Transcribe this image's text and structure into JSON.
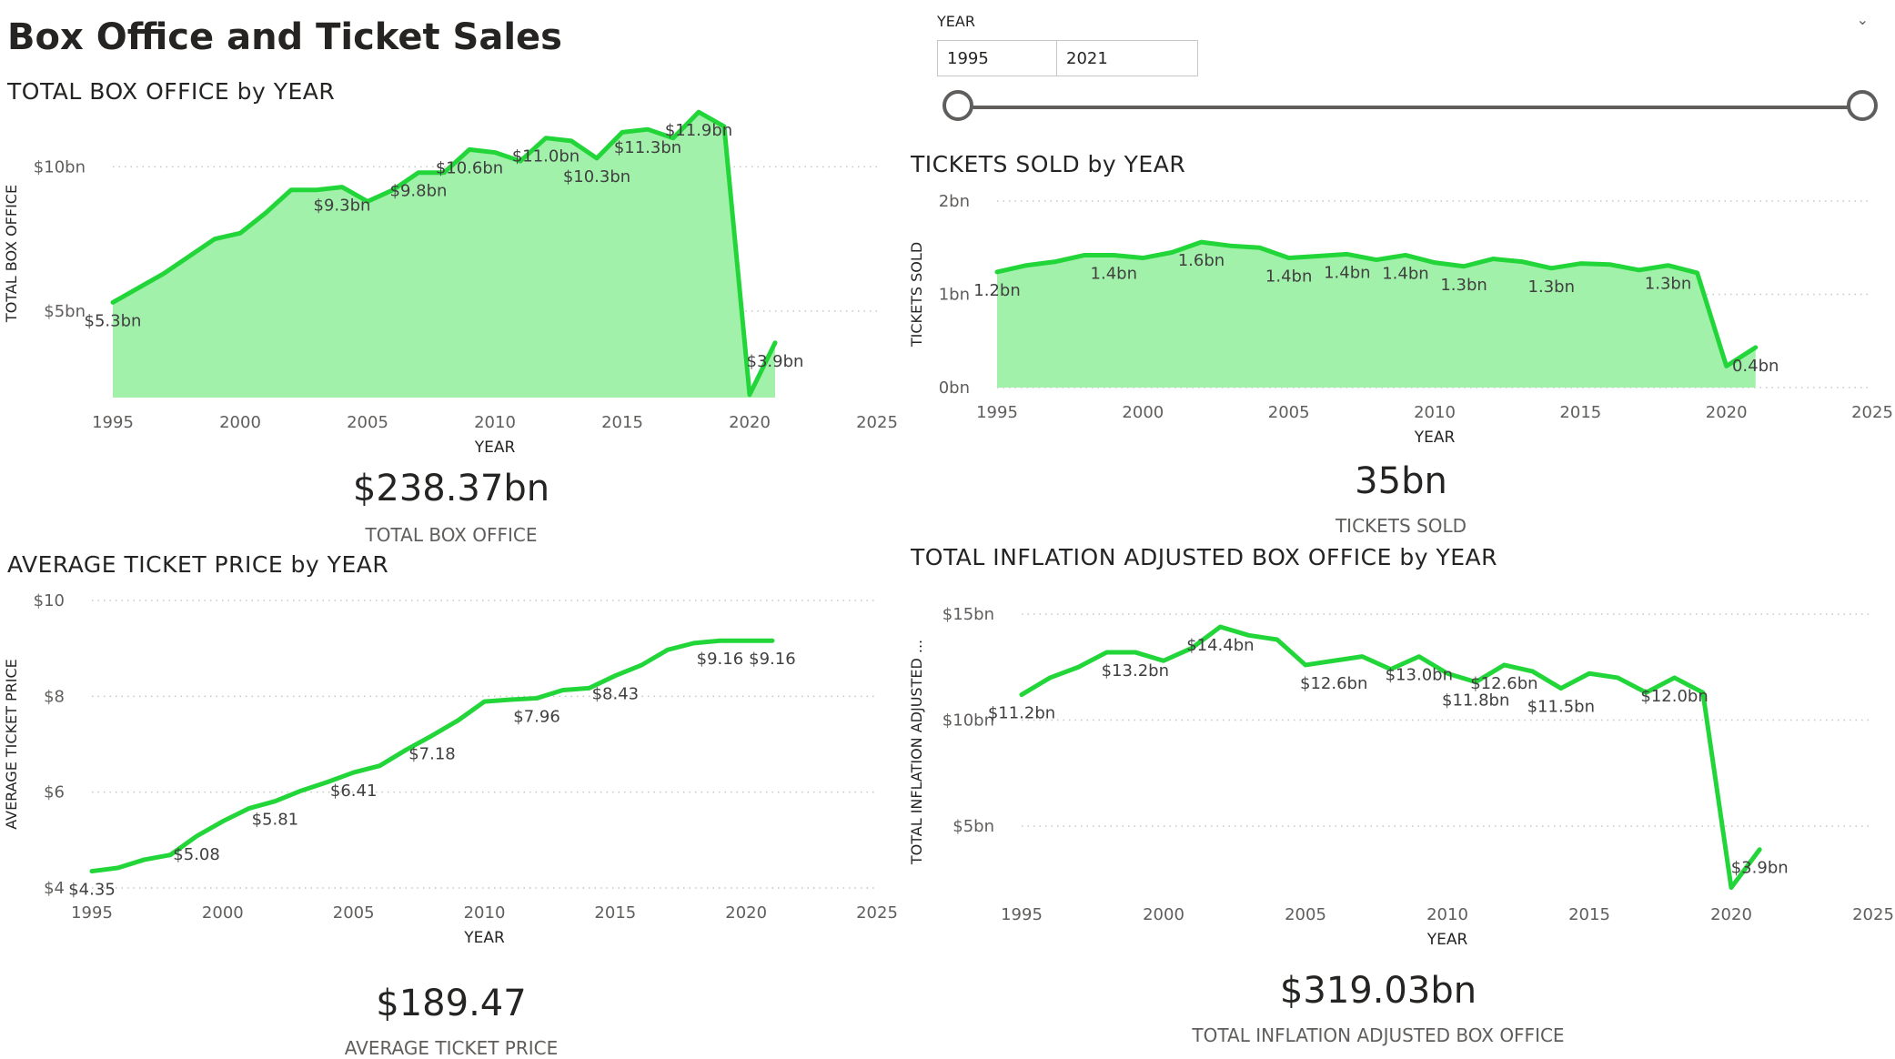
{
  "page_title": "Box Office and Ticket Sales",
  "slicer": {
    "title": "YEAR",
    "from": "1995",
    "to": "2021",
    "range": [
      1995,
      2021
    ]
  },
  "colors": {
    "line": "#22d63a",
    "area": "#a2f1ab",
    "text": "#605e5c",
    "grid": "#c8c6c4"
  },
  "cards": {
    "box_office": {
      "value": "$238.37bn",
      "label": "TOTAL BOX OFFICE"
    },
    "tickets": {
      "value": "35bn",
      "label": "TICKETS SOLD"
    },
    "avg_price": {
      "value": "$189.47",
      "label": "AVERAGE TICKET PRICE"
    },
    "inflation": {
      "value": "$319.03bn",
      "label": "TOTAL INFLATION ADJUSTED BOX OFFICE"
    }
  },
  "chart_data": [
    {
      "type": "area",
      "title": "TOTAL BOX OFFICE by YEAR",
      "xlabel": "YEAR",
      "ylabel": "TOTAL BOX OFFICE",
      "xlim": [
        1995,
        2025
      ],
      "x_ticks": [
        "1995",
        "2000",
        "2005",
        "2010",
        "2015",
        "2020",
        "2025"
      ],
      "ylim": [
        2,
        12
      ],
      "y_ticks": [
        {
          "value": 5,
          "label": "$5bn"
        },
        {
          "value": 10,
          "label": "$10bn"
        }
      ],
      "grid": true,
      "x": [
        1995,
        1996,
        1997,
        1998,
        1999,
        2000,
        2001,
        2002,
        2003,
        2004,
        2005,
        2006,
        2007,
        2008,
        2009,
        2010,
        2011,
        2012,
        2013,
        2014,
        2015,
        2016,
        2017,
        2018,
        2019,
        2020,
        2021
      ],
      "values": [
        5.3,
        5.8,
        6.3,
        6.9,
        7.5,
        7.7,
        8.4,
        9.2,
        9.2,
        9.3,
        8.8,
        9.2,
        9.8,
        9.8,
        10.6,
        10.5,
        10.2,
        11.0,
        10.9,
        10.3,
        11.2,
        11.3,
        11.0,
        11.9,
        11.4,
        2.1,
        3.9
      ],
      "data_labels": [
        {
          "x": 1995,
          "y": 5.3,
          "label": "$5.3bn"
        },
        {
          "x": 2004,
          "y": 9.3,
          "label": "$9.3bn"
        },
        {
          "x": 2007,
          "y": 9.8,
          "label": "$9.8bn"
        },
        {
          "x": 2009,
          "y": 10.6,
          "label": "$10.6bn"
        },
        {
          "x": 2012,
          "y": 11.0,
          "label": "$11.0bn"
        },
        {
          "x": 2014,
          "y": 10.3,
          "label": "$10.3bn"
        },
        {
          "x": 2016,
          "y": 11.3,
          "label": "$11.3bn"
        },
        {
          "x": 2018,
          "y": 11.9,
          "label": "$11.9bn"
        },
        {
          "x": 2021,
          "y": 3.9,
          "label": "$3.9bn"
        }
      ]
    },
    {
      "type": "area",
      "title": "TICKETS SOLD by YEAR",
      "xlabel": "YEAR",
      "ylabel": "TICKETS SOLD",
      "xlim": [
        1995,
        2025
      ],
      "x_ticks": [
        "1995",
        "2000",
        "2005",
        "2010",
        "2015",
        "2020",
        "2025"
      ],
      "ylim": [
        0,
        2
      ],
      "y_ticks": [
        {
          "value": 0,
          "label": "0bn"
        },
        {
          "value": 1,
          "label": "1bn"
        },
        {
          "value": 2,
          "label": "2bn"
        }
      ],
      "grid": true,
      "x": [
        1995,
        1996,
        1997,
        1998,
        1999,
        2000,
        2001,
        2002,
        2003,
        2004,
        2005,
        2006,
        2007,
        2008,
        2009,
        2010,
        2011,
        2012,
        2013,
        2014,
        2015,
        2016,
        2017,
        2018,
        2019,
        2020,
        2021
      ],
      "values": [
        1.24,
        1.31,
        1.35,
        1.42,
        1.42,
        1.39,
        1.45,
        1.56,
        1.52,
        1.5,
        1.39,
        1.41,
        1.43,
        1.37,
        1.42,
        1.34,
        1.3,
        1.38,
        1.35,
        1.28,
        1.33,
        1.32,
        1.26,
        1.31,
        1.23,
        0.23,
        0.43
      ],
      "data_labels": [
        {
          "x": 1995,
          "y": 1.24,
          "label": "1.2bn"
        },
        {
          "x": 1999,
          "y": 1.42,
          "label": "1.4bn"
        },
        {
          "x": 2002,
          "y": 1.56,
          "label": "1.6bn"
        },
        {
          "x": 2005,
          "y": 1.39,
          "label": "1.4bn"
        },
        {
          "x": 2007,
          "y": 1.43,
          "label": "1.4bn"
        },
        {
          "x": 2009,
          "y": 1.42,
          "label": "1.4bn"
        },
        {
          "x": 2011,
          "y": 1.3,
          "label": "1.3bn"
        },
        {
          "x": 2014,
          "y": 1.28,
          "label": "1.3bn"
        },
        {
          "x": 2018,
          "y": 1.31,
          "label": "1.3bn"
        },
        {
          "x": 2021,
          "y": 0.43,
          "label": "0.4bn"
        }
      ]
    },
    {
      "type": "line",
      "title": "AVERAGE TICKET PRICE by YEAR",
      "xlabel": "YEAR",
      "ylabel": "AVERAGE TICKET PRICE",
      "xlim": [
        1995,
        2025
      ],
      "x_ticks": [
        "1995",
        "2000",
        "2005",
        "2010",
        "2015",
        "2020",
        "2025"
      ],
      "ylim": [
        4,
        10
      ],
      "y_ticks": [
        {
          "value": 4,
          "label": "$4"
        },
        {
          "value": 6,
          "label": "$6"
        },
        {
          "value": 8,
          "label": "$8"
        },
        {
          "value": 10,
          "label": "$10"
        }
      ],
      "grid": true,
      "x": [
        1995,
        1996,
        1997,
        1998,
        1999,
        2000,
        2001,
        2002,
        2003,
        2004,
        2005,
        2006,
        2007,
        2008,
        2009,
        2010,
        2011,
        2012,
        2013,
        2014,
        2015,
        2016,
        2017,
        2018,
        2019,
        2020,
        2021
      ],
      "values": [
        4.35,
        4.42,
        4.59,
        4.69,
        5.08,
        5.39,
        5.66,
        5.81,
        6.03,
        6.21,
        6.41,
        6.55,
        6.88,
        7.18,
        7.5,
        7.89,
        7.93,
        7.96,
        8.13,
        8.17,
        8.43,
        8.65,
        8.97,
        9.11,
        9.16,
        9.16,
        9.16
      ],
      "data_labels": [
        {
          "x": 1995,
          "y": 4.35,
          "label": "$4.35"
        },
        {
          "x": 1999,
          "y": 5.08,
          "label": "$5.08"
        },
        {
          "x": 2002,
          "y": 5.81,
          "label": "$5.81"
        },
        {
          "x": 2005,
          "y": 6.41,
          "label": "$6.41"
        },
        {
          "x": 2008,
          "y": 7.18,
          "label": "$7.18"
        },
        {
          "x": 2012,
          "y": 7.96,
          "label": "$7.96"
        },
        {
          "x": 2015,
          "y": 8.43,
          "label": "$8.43"
        },
        {
          "x": 2019,
          "y": 9.16,
          "label": "$9.16"
        },
        {
          "x": 2021,
          "y": 9.16,
          "label": "$9.16"
        }
      ]
    },
    {
      "type": "line",
      "title": "TOTAL INFLATION ADJUSTED BOX OFFICE by YEAR",
      "xlabel": "YEAR",
      "ylabel": "TOTAL INFLATION ADJUSTED ...",
      "xlim": [
        1995,
        2025
      ],
      "x_ticks": [
        "1995",
        "2000",
        "2005",
        "2010",
        "2015",
        "2020",
        "2025"
      ],
      "ylim": [
        2,
        15
      ],
      "y_ticks": [
        {
          "value": 5,
          "label": "$5bn"
        },
        {
          "value": 10,
          "label": "$10bn"
        },
        {
          "value": 15,
          "label": "$15bn"
        }
      ],
      "grid": true,
      "x": [
        1995,
        1996,
        1997,
        1998,
        1999,
        2000,
        2001,
        2002,
        2003,
        2004,
        2005,
        2006,
        2007,
        2008,
        2009,
        2010,
        2011,
        2012,
        2013,
        2014,
        2015,
        2016,
        2017,
        2018,
        2019,
        2020,
        2021
      ],
      "values": [
        11.2,
        12.0,
        12.5,
        13.2,
        13.2,
        12.8,
        13.4,
        14.4,
        14.0,
        13.8,
        12.6,
        12.8,
        13.0,
        12.4,
        13.0,
        12.2,
        11.8,
        12.6,
        12.3,
        11.5,
        12.2,
        12.0,
        11.3,
        12.0,
        11.3,
        2.1,
        3.9
      ],
      "data_labels": [
        {
          "x": 1995,
          "y": 11.2,
          "label": "$11.2bn"
        },
        {
          "x": 1999,
          "y": 13.2,
          "label": "$13.2bn"
        },
        {
          "x": 2002,
          "y": 14.4,
          "label": "$14.4bn"
        },
        {
          "x": 2006,
          "y": 12.6,
          "label": "$12.6bn"
        },
        {
          "x": 2009,
          "y": 13.0,
          "label": "$13.0bn"
        },
        {
          "x": 2011,
          "y": 11.8,
          "label": "$11.8bn"
        },
        {
          "x": 2012,
          "y": 12.6,
          "label": "$12.6bn"
        },
        {
          "x": 2014,
          "y": 11.5,
          "label": "$11.5bn"
        },
        {
          "x": 2018,
          "y": 12.0,
          "label": "$12.0bn"
        },
        {
          "x": 2021,
          "y": 3.9,
          "label": "$3.9bn"
        }
      ]
    }
  ]
}
